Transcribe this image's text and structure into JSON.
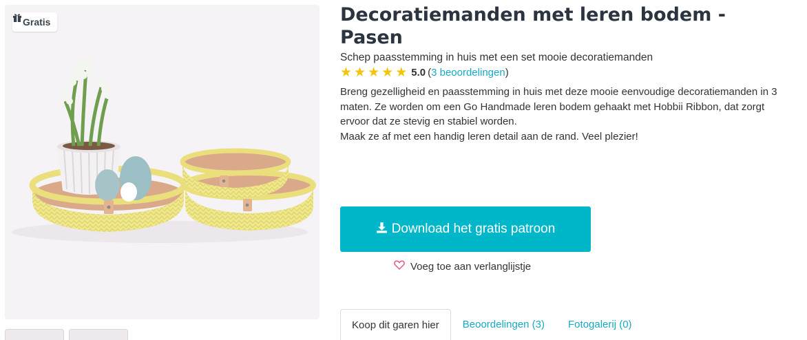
{
  "product": {
    "badge_label": "Gratis",
    "title": "Decoratiemanden met leren bodem - Pasen",
    "subtitle": "Schep paasstemming in huis met een set mooie decoratiemanden",
    "rating": {
      "stars": 5,
      "score": "5.0",
      "open_paren": "(",
      "reviews_label": "3 beoordelingen",
      "close_paren": ")"
    },
    "description_lines": [
      "Breng gezelligheid en paasstemming in huis met deze mooie eenvoudige decoratiemanden in 3 maten. Ze worden om een Go Handmade leren bodem gehaakt met Hobbii Ribbon, dat zorgt ervoor dat ze stevig en stabiel worden.",
      "Maak ze af met een handig leren detail aan de rand. Veel plezier!"
    ],
    "download_label": "Download het gratis patroon",
    "wishlist_label": "Voeg toe aan verlanglijstje"
  },
  "tabs": [
    {
      "label": "Koop dit garen hier",
      "active": true
    },
    {
      "label": "Beoordelingen (3)",
      "active": false
    },
    {
      "label": "Fotogalerij (0)",
      "active": false
    }
  ],
  "colors": {
    "accent": "#00b7c9",
    "link": "#17a9c4",
    "star": "#f2c50b",
    "heart": "#e5568a",
    "basket": "#f2ea92"
  },
  "icons": {
    "badge": "gift-icon",
    "download": "download-icon",
    "wishlist": "heart-outline-icon",
    "rating": "star-icon"
  }
}
